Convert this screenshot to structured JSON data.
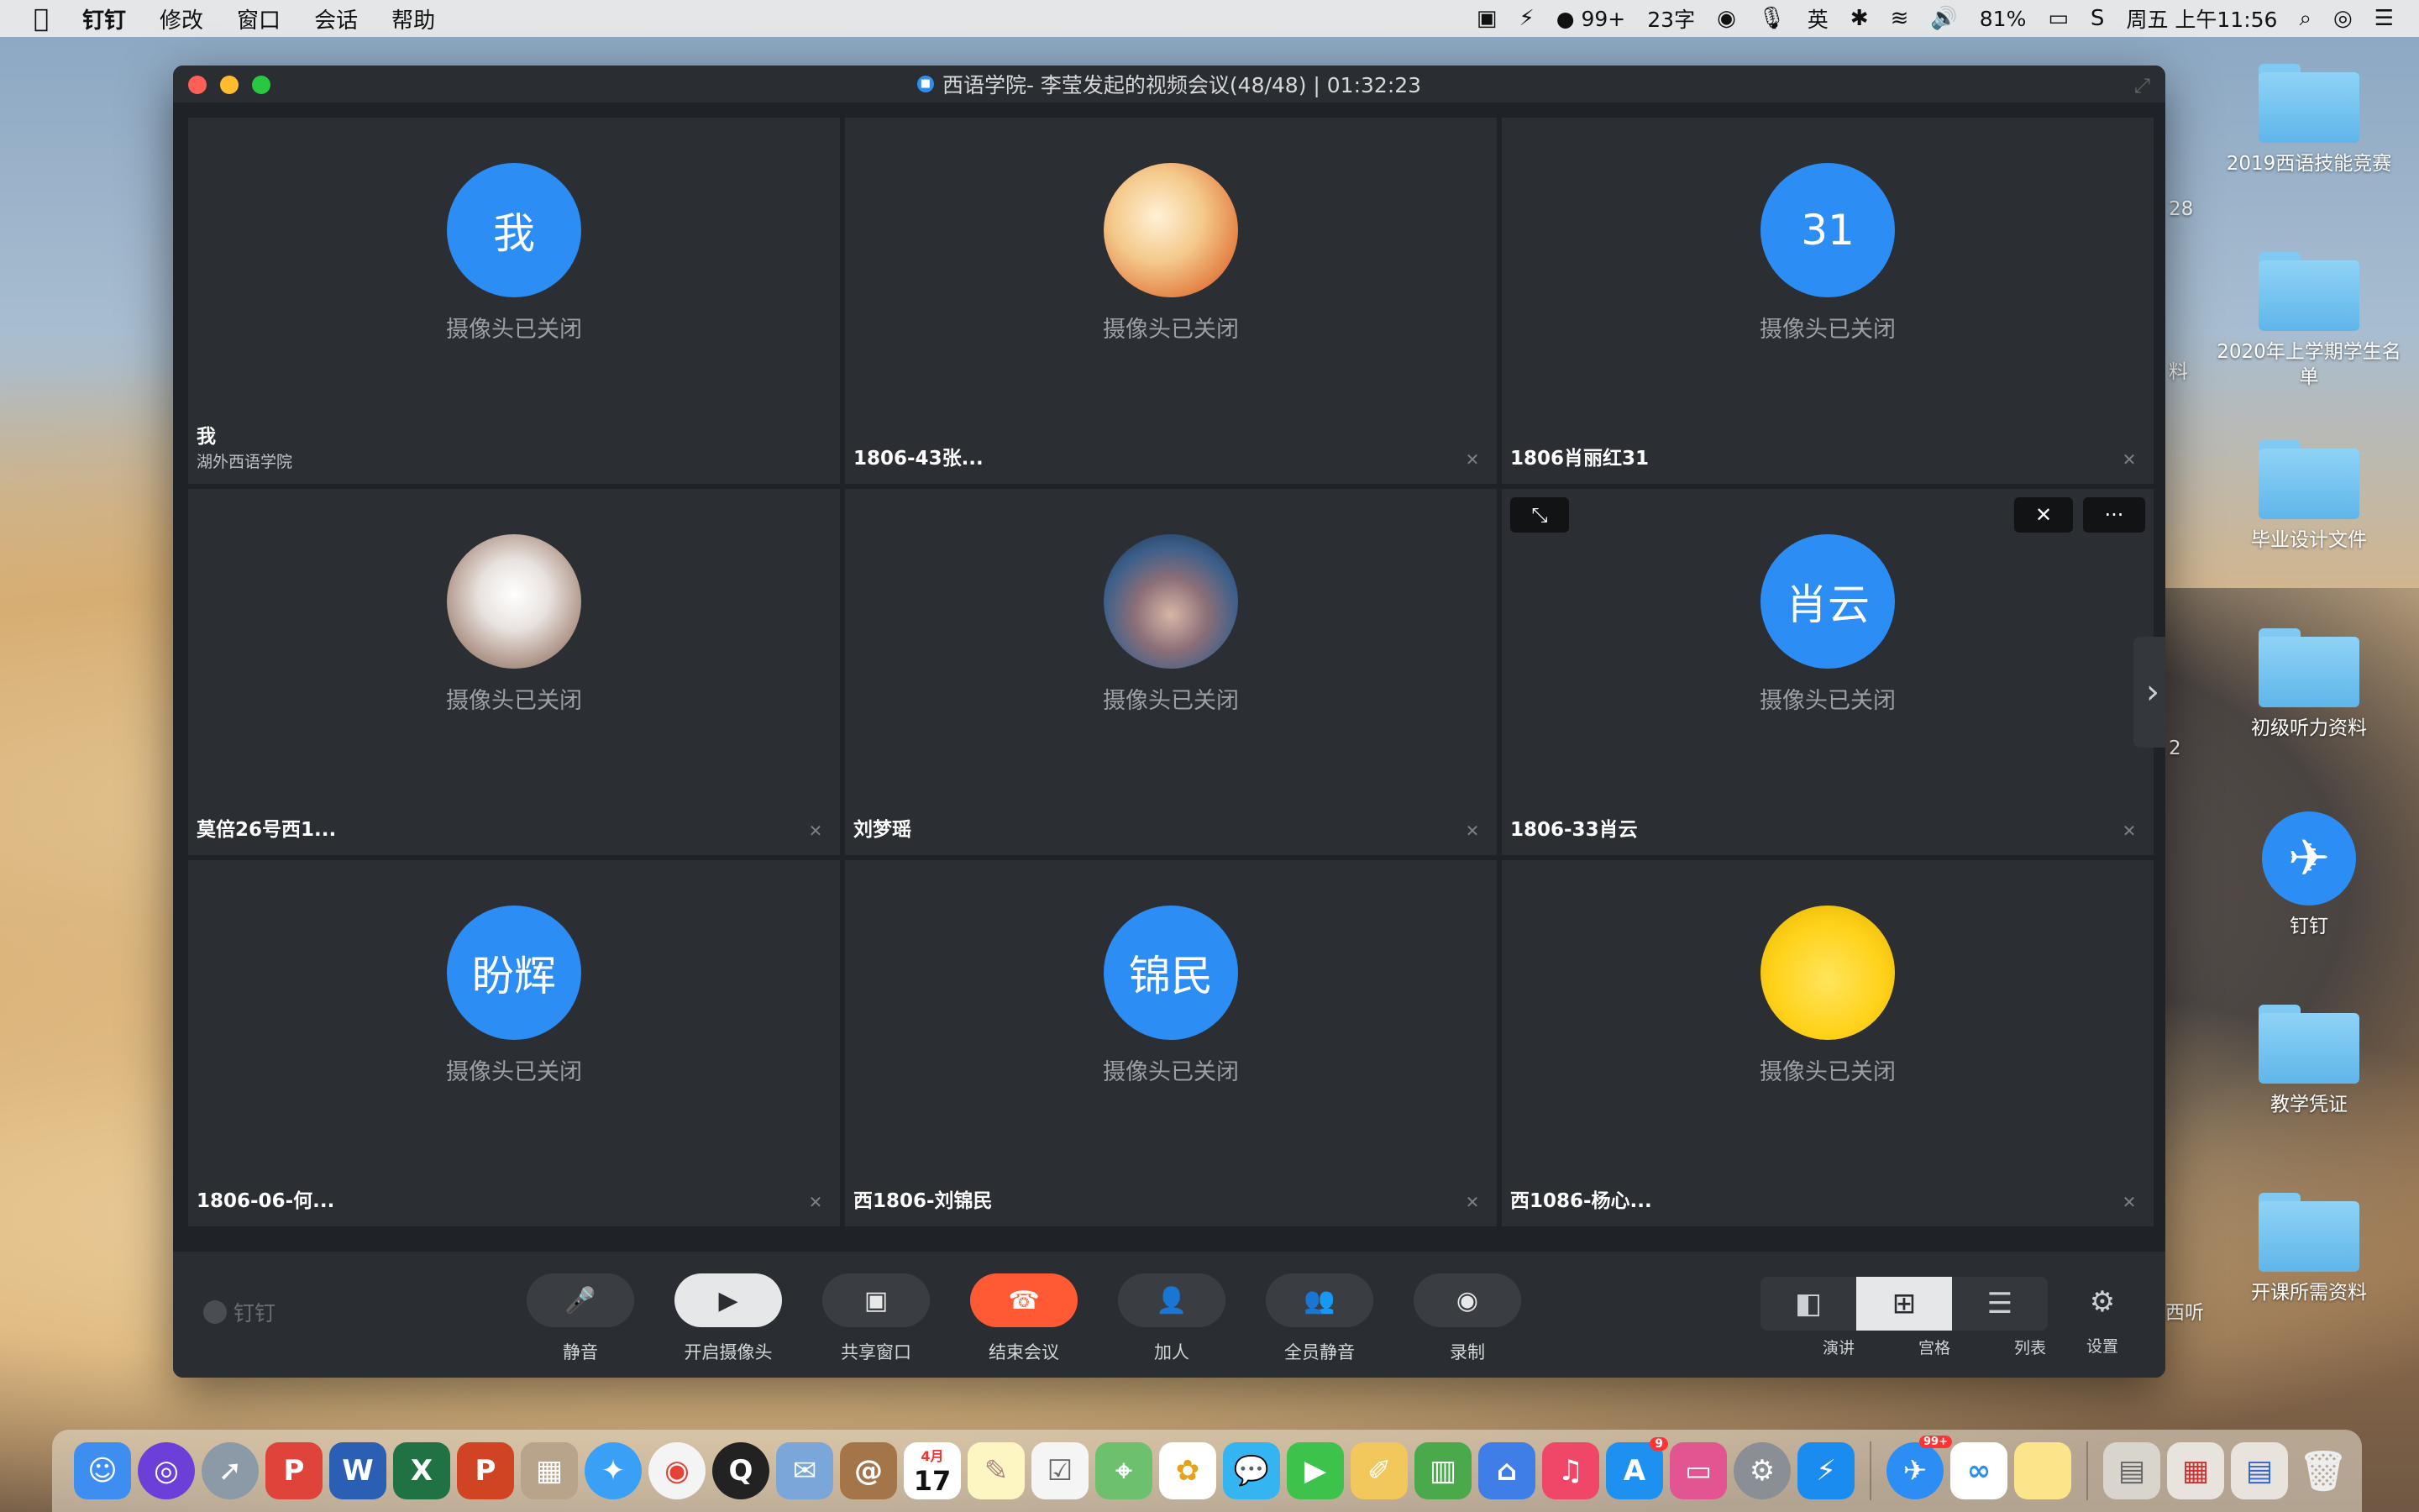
{
  "menubar": {
    "app_name": "钉钉",
    "menus": [
      "修改",
      "窗口",
      "会话",
      "帮助"
    ],
    "status": {
      "notifications": "99+",
      "word_count": "23字",
      "input_method": "英",
      "battery": "81%",
      "clock": "周五 上午11:56"
    }
  },
  "desktop": {
    "items": [
      {
        "label": "2019西语技能竞赛"
      },
      {
        "label": "2020年上学期学生名单"
      },
      {
        "label": "毕业设计文件"
      },
      {
        "label": "初级听力资料"
      },
      {
        "label": "钉钉"
      },
      {
        "label": "教学凭证"
      },
      {
        "label": "开课所需资料"
      }
    ],
    "partial_labels": [
      "28",
      "料",
      "2",
      "西听"
    ]
  },
  "window": {
    "title": "西语学院- 李莹发起的视频会议(48/48) | 01:32:23",
    "camera_off_text": "摄像头已关闭",
    "tiles": [
      {
        "avatar_text": "我",
        "name": "我",
        "org": "湖外西语学院"
      },
      {
        "avatar_text": "",
        "name": "1806-43张..."
      },
      {
        "avatar_text": "31",
        "name": "1806肖丽红31"
      },
      {
        "avatar_text": "",
        "name": "莫倍26号西1..."
      },
      {
        "avatar_text": "",
        "name": "刘梦瑶"
      },
      {
        "avatar_text": "肖云",
        "name": "1806-33肖云"
      },
      {
        "avatar_text": "盼辉",
        "name": "1806-06-何..."
      },
      {
        "avatar_text": "锦民",
        "name": "西1806-刘锦民"
      },
      {
        "avatar_text": "",
        "name": "西1086-杨心..."
      }
    ],
    "tile_more_label": "···"
  },
  "toolbar": {
    "brand": "钉钉",
    "buttons": [
      {
        "label": "静音",
        "icon": "microphone-icon"
      },
      {
        "label": "开启摄像头",
        "icon": "camera-off-icon"
      },
      {
        "label": "共享窗口",
        "icon": "share-screen-icon"
      },
      {
        "label": "结束会议",
        "icon": "hangup-icon"
      },
      {
        "label": "加人",
        "icon": "add-person-icon"
      },
      {
        "label": "全员静音",
        "icon": "mute-all-icon"
      },
      {
        "label": "录制",
        "icon": "record-icon"
      }
    ],
    "views": [
      {
        "label": "演讲",
        "active": false
      },
      {
        "label": "宫格",
        "active": true
      },
      {
        "label": "列表",
        "active": false
      }
    ],
    "settings_label": "设置"
  },
  "dock": {
    "badges": {
      "appstore": "9",
      "dingtalk": "99+"
    },
    "calendar": {
      "month": "4月",
      "day": "17"
    }
  },
  "colors": {
    "accent": "#2c8df4",
    "danger": "#ff5a33",
    "window_bg": "#1f2226",
    "tile_bg": "#2b2e33"
  }
}
